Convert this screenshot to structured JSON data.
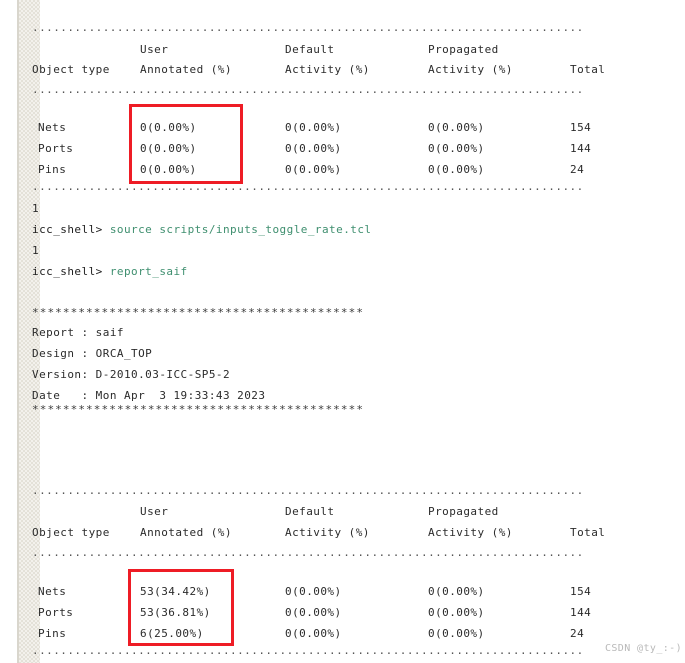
{
  "terminal": {
    "prompt": "icc_shell>",
    "colors": {
      "command_green": "#3f8f6f",
      "text": "#2b2b2b",
      "annotation_red": "#ee1c25",
      "gutter": "#f3f1ec"
    }
  },
  "table_top": {
    "rule_top": "..............................................................................",
    "rule_mid": "..............................................................................",
    "rule_bottom": "..............................................................................",
    "headers_line1": [
      "",
      "User",
      "Default",
      "Propagated",
      ""
    ],
    "headers_line2": [
      "Object type",
      "Annotated (%)",
      "Activity (%)",
      "Activity (%)",
      "Total"
    ],
    "rows": [
      {
        "object_type": "Nets",
        "user_annotated": "0(0.00%)",
        "default_activity": "0(0.00%)",
        "propagated_activity": "0(0.00%)",
        "total": "154"
      },
      {
        "object_type": "Ports",
        "user_annotated": "0(0.00%)",
        "default_activity": "0(0.00%)",
        "propagated_activity": "0(0.00%)",
        "total": "144"
      },
      {
        "object_type": "Pins",
        "user_annotated": "0(0.00%)",
        "default_activity": "0(0.00%)",
        "propagated_activity": "0(0.00%)",
        "total": "24"
      }
    ]
  },
  "session": {
    "return_1_a": "1",
    "command_1_prompt": "icc_shell>",
    "command_1_text": "source scripts/inputs_toggle_rate.tcl",
    "return_1_b": "1",
    "command_2_prompt": "icc_shell>",
    "command_2_text": "report_saif"
  },
  "report_header": {
    "stars_top": "*******************************************",
    "lines": [
      {
        "label": "Report ",
        "sep": ": ",
        "value": "saif"
      },
      {
        "label": "Design ",
        "sep": ": ",
        "value": "ORCA_TOP"
      },
      {
        "label": "Version",
        "sep": ": ",
        "value": "D-2010.03-ICC-SP5-2"
      },
      {
        "label": "Date   ",
        "sep": ": ",
        "value": "Mon Apr  3 19:33:43 2023"
      }
    ],
    "stars_bottom": "*******************************************"
  },
  "table_bottom": {
    "rule_top": "..............................................................................",
    "rule_mid": "..............................................................................",
    "rule_bottom": "..............................................................................",
    "headers_line1": [
      "",
      "User",
      "Default",
      "Propagated",
      ""
    ],
    "headers_line2": [
      "Object type",
      "Annotated (%)",
      "Activity (%)",
      "Activity (%)",
      "Total"
    ],
    "rows": [
      {
        "object_type": "Nets",
        "user_annotated": "53(34.42%)",
        "default_activity": "0(0.00%)",
        "propagated_activity": "0(0.00%)",
        "total": "154"
      },
      {
        "object_type": "Ports",
        "user_annotated": "53(36.81%)",
        "default_activity": "0(0.00%)",
        "propagated_activity": "0(0.00%)",
        "total": "144"
      },
      {
        "object_type": "Pins",
        "user_annotated": "6(25.00%)",
        "default_activity": "0(0.00%)",
        "propagated_activity": "0(0.00%)",
        "total": "24"
      }
    ]
  },
  "annotations": {
    "highlight_top_label": "user-annotated-column-highlight",
    "highlight_bottom_label": "user-annotated-column-highlight"
  },
  "watermark": {
    "text": "CSDN @ty_:-)"
  }
}
